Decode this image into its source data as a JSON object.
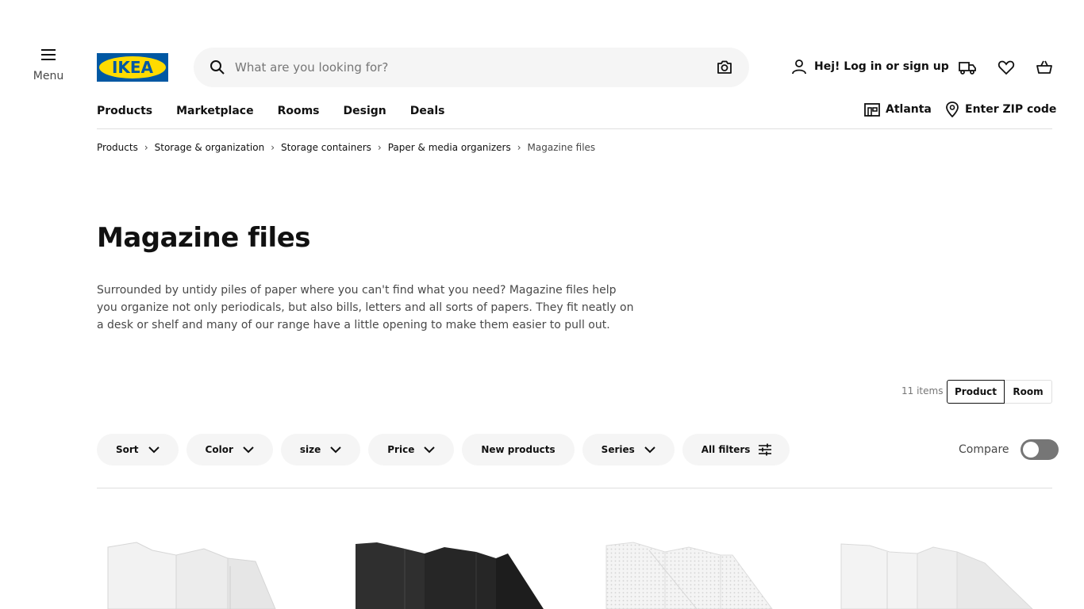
{
  "header": {
    "menu_label": "Menu",
    "logo_text": "IKEA",
    "search_placeholder": "What are you looking for?",
    "login_label": "Hej! Log in or sign up"
  },
  "nav": {
    "items": [
      "Products",
      "Marketplace",
      "Rooms",
      "Design",
      "Deals"
    ],
    "store_label": "Atlanta",
    "zip_label": "Enter ZIP code"
  },
  "breadcrumb": [
    "Products",
    "Storage & organization",
    "Storage containers",
    "Paper & media organizers",
    "Magazine files"
  ],
  "page": {
    "title": "Magazine files",
    "description": "Surrounded by untidy piles of paper where you can't find what you need? Magazine files help you organize not only periodicals, but also bills, letters and all sorts of papers. They fit neatly on a desk or shelf and many of our range have a little opening to make them easier to pull out."
  },
  "listing": {
    "items_count": "11 items",
    "view_product": "Product",
    "view_room": "Room",
    "compare_label": "Compare"
  },
  "filters": [
    "Sort",
    "Color",
    "size",
    "Price",
    "New products",
    "Series",
    "All filters"
  ],
  "colors": {
    "brand_blue": "#0058a3",
    "brand_yellow": "#ffdb00",
    "pill_bg": "#f5f5f5",
    "toggle_off": "#767676"
  }
}
